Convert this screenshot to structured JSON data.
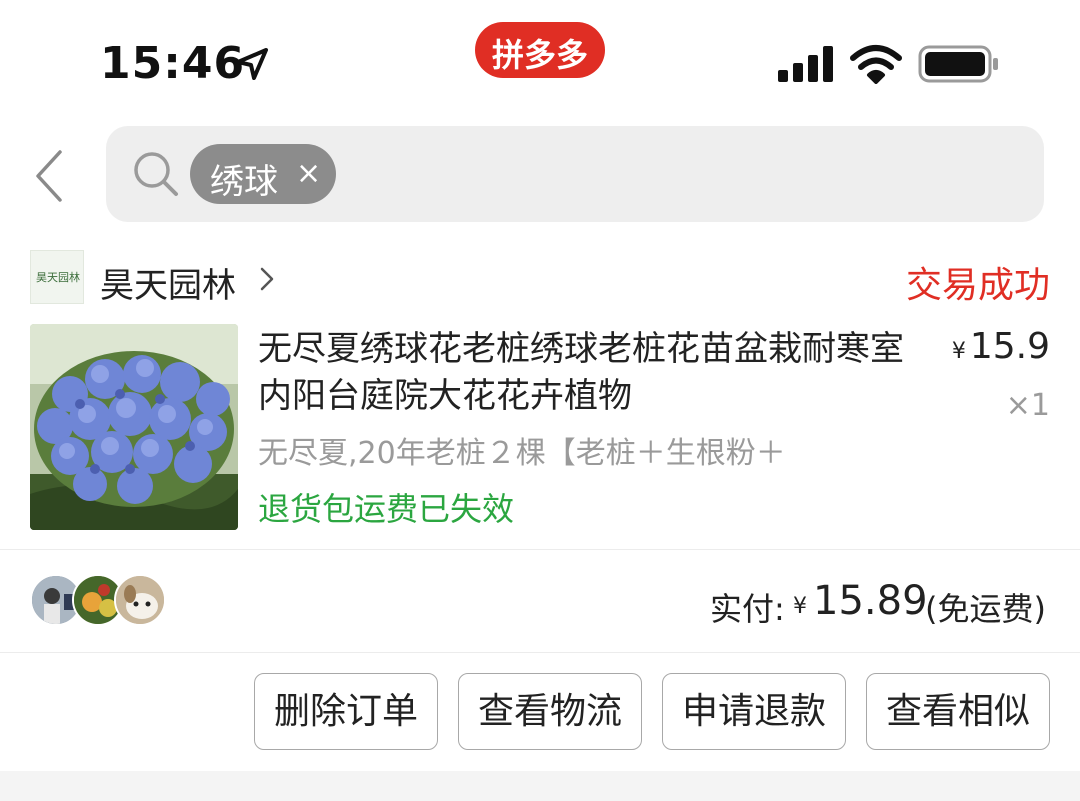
{
  "status_bar": {
    "time": "15:46",
    "app_badge": "拼多多",
    "icons": [
      "location-arrow-icon",
      "cellular-signal-icon",
      "wifi-icon",
      "battery-icon"
    ]
  },
  "search": {
    "chip_text": "绣球",
    "chip_close": "×"
  },
  "shop": {
    "logo_text": "昊天园林",
    "name": "昊天园林",
    "order_status": "交易成功"
  },
  "product": {
    "title": "无尽夏绣球花老桩绣球老桩花苗盆栽耐寒室内阳台庭院大花花卉植物",
    "currency": "¥",
    "price": "15.9",
    "quantity": "×1",
    "spec": "无尽夏,20年老桩２棵【老桩＋生根粉＋",
    "return_note": "退货包运费已失效"
  },
  "payment": {
    "label": "实付:",
    "currency": "¥",
    "amount": "15.89",
    "note": "(免运费)"
  },
  "actions": {
    "delete_order": "删除订单",
    "view_logistics": "查看物流",
    "request_refund": "申请退款",
    "view_similar": "查看相似"
  },
  "colors": {
    "brand_red": "#e02e24",
    "success_green": "#2ba640",
    "muted_gray": "#9a9a9a",
    "search_bg": "#eeeeee"
  }
}
